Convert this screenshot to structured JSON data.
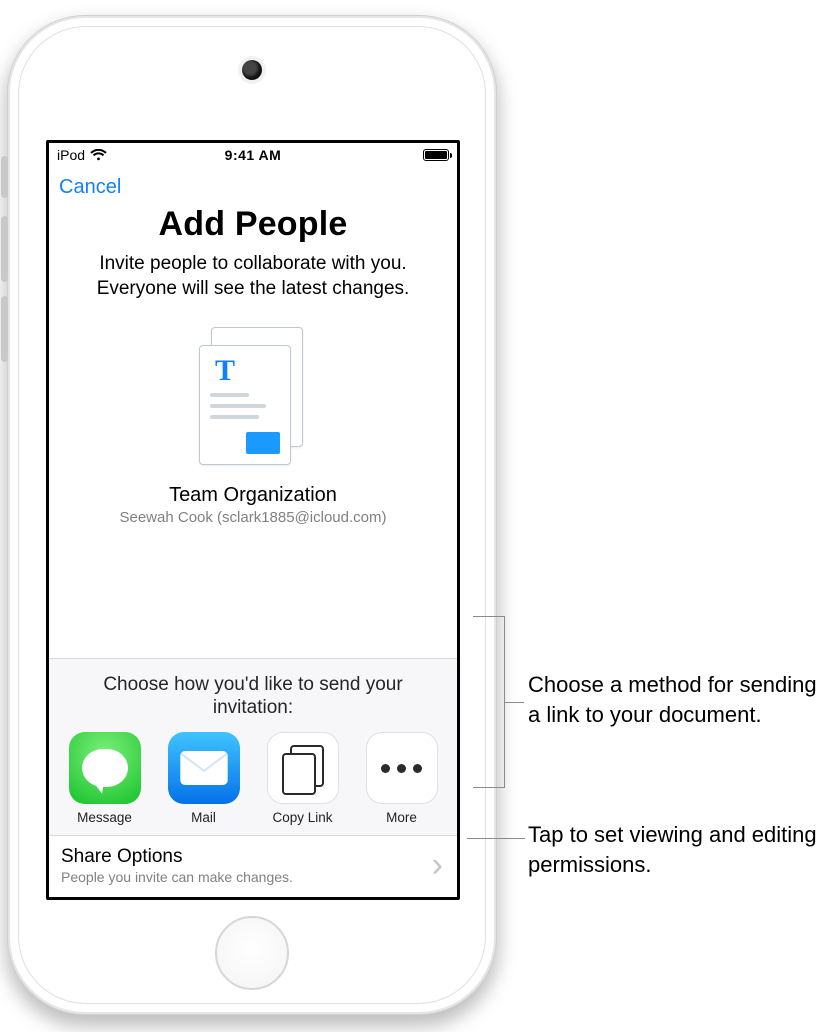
{
  "status": {
    "carrier": "iPod",
    "time": "9:41 AM"
  },
  "nav": {
    "cancel": "Cancel"
  },
  "header": {
    "title": "Add People",
    "subtitle": "Invite people to collaborate with you. Everyone will see the latest changes."
  },
  "document": {
    "name": "Team Organization",
    "owner": "Seewah Cook (sclark1885@icloud.com)"
  },
  "invite": {
    "prompt": "Choose how you'd like to send your invitation:",
    "methods": {
      "message": "Message",
      "mail": "Mail",
      "copy_link": "Copy Link",
      "more": "More"
    }
  },
  "share_options": {
    "title": "Share Options",
    "detail": "People you invite can make changes."
  },
  "callouts": {
    "c1": "Choose a method for sending a link to your document.",
    "c2": "Tap to set viewing and editing permissions."
  }
}
